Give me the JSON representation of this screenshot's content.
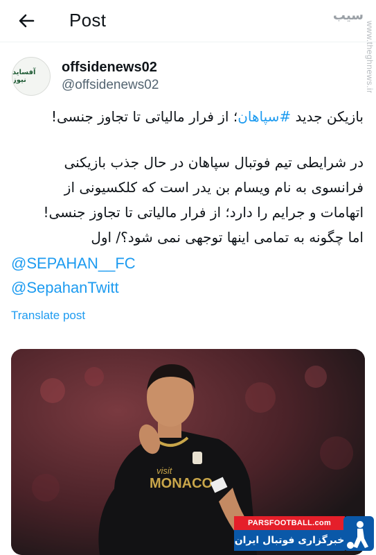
{
  "header": {
    "title": "Post"
  },
  "watermark": {
    "vertical_text": "www.theghnews.ir",
    "logo_text": "سیب"
  },
  "author": {
    "display_name": "offsidenews02",
    "handle": "@offsidenews02",
    "avatar_text": "آفساید نیوز"
  },
  "tweet": {
    "headline_prefix": "بازیکن جدید ",
    "headline_hashtag": "#سپاهان",
    "headline_suffix": "؛ از فرار مالیاتی تا تجاوز جنسی!",
    "body_line1": "در شرایطی تیم فوتبال سپاهان در حال جذب بازیکنی",
    "body_line2": "فرانسوی به نام ویسام بن یدر است که کلکسیونی از",
    "body_line3": "اتهامات و جرایم را دارد؛ از فرار مالیاتی تا تجاوز جنسی!",
    "body_line4": "اما چگونه به تمامی اینها توجهی نمی شود؟/ اول",
    "mention1": "@SEPAHAN__FC",
    "mention2": "@SepahanTwitt",
    "translate_label": "Translate post"
  },
  "media": {
    "shirt_text_top": "visit",
    "shirt_text_main": "MONACO",
    "sponsor_top": "PARSFOOTBALL.com",
    "sponsor_bottom": "خبرگزاری فوتبال ایران"
  },
  "colors": {
    "link": "#1d9bf0",
    "text": "#0f1419",
    "secondary": "#536471",
    "pf_red": "#e51f2a",
    "pf_blue": "#0a58a8"
  }
}
